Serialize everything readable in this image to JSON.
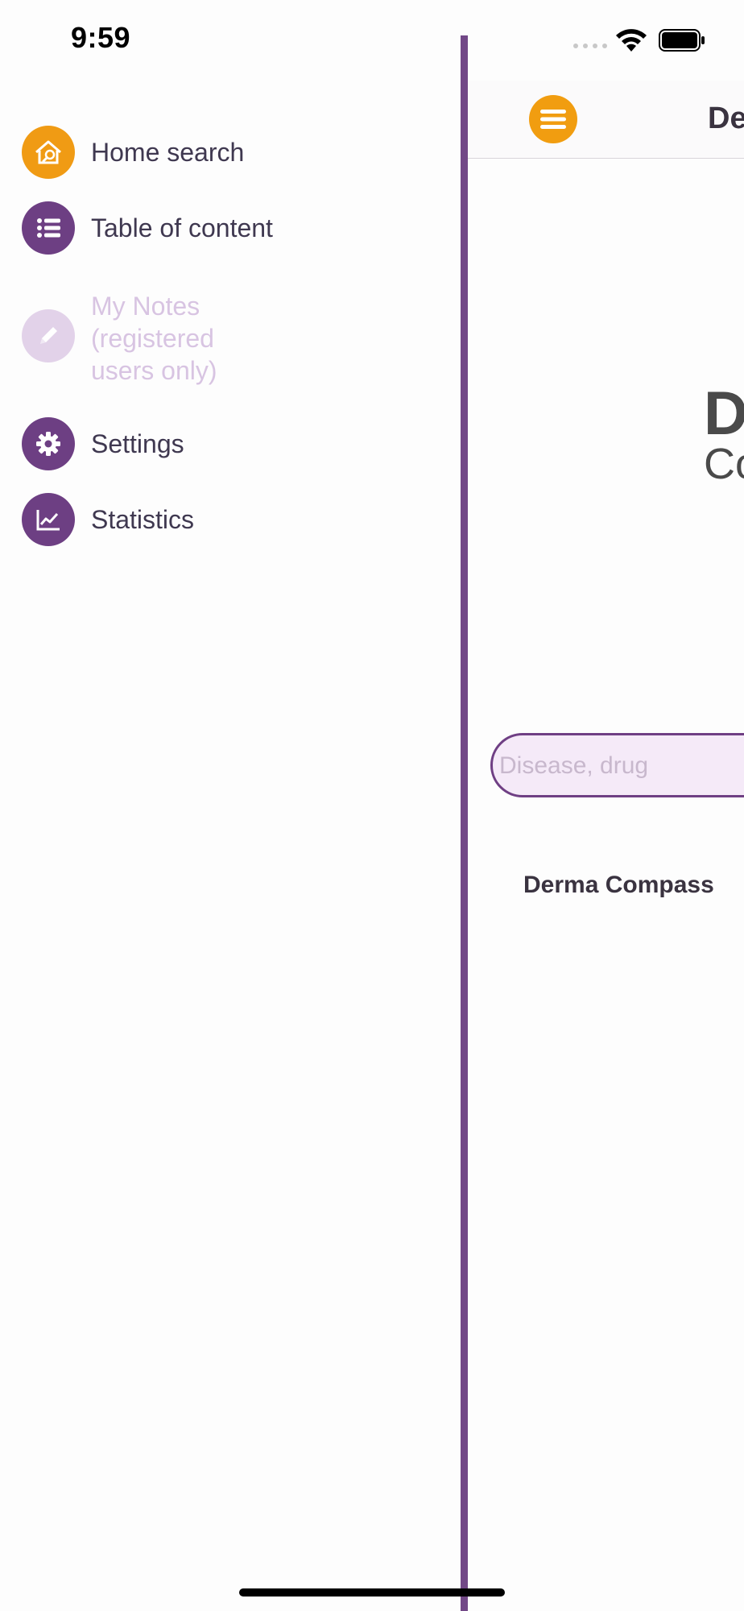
{
  "status_bar": {
    "time": "9:59",
    "wifi_icon": "wifi-icon",
    "battery_icon": "battery-icon"
  },
  "drawer": {
    "items": [
      {
        "label": "Home search",
        "icon": "home-search-icon",
        "color": "#f09b14",
        "enabled": true
      },
      {
        "label": "Table of content",
        "icon": "list-icon",
        "color": "#6d3f83",
        "enabled": true
      },
      {
        "label": "My Notes\n(registered\nusers only)",
        "icon": "pencil-icon",
        "color": "#e2d2e9",
        "enabled": false
      },
      {
        "label": "Settings",
        "icon": "gear-icon",
        "color": "#6d3f83",
        "enabled": true
      },
      {
        "label": "Statistics",
        "icon": "chart-icon",
        "color": "#6d3f83",
        "enabled": true
      }
    ]
  },
  "main": {
    "header_title": "De",
    "logo_text": "D",
    "logo_subtext": "Co",
    "search": {
      "placeholder": "Disease, drug",
      "value": ""
    },
    "brand_line": "Derma Compass"
  },
  "colors": {
    "accent_purple": "#724887",
    "accent_orange": "#f09b14"
  }
}
